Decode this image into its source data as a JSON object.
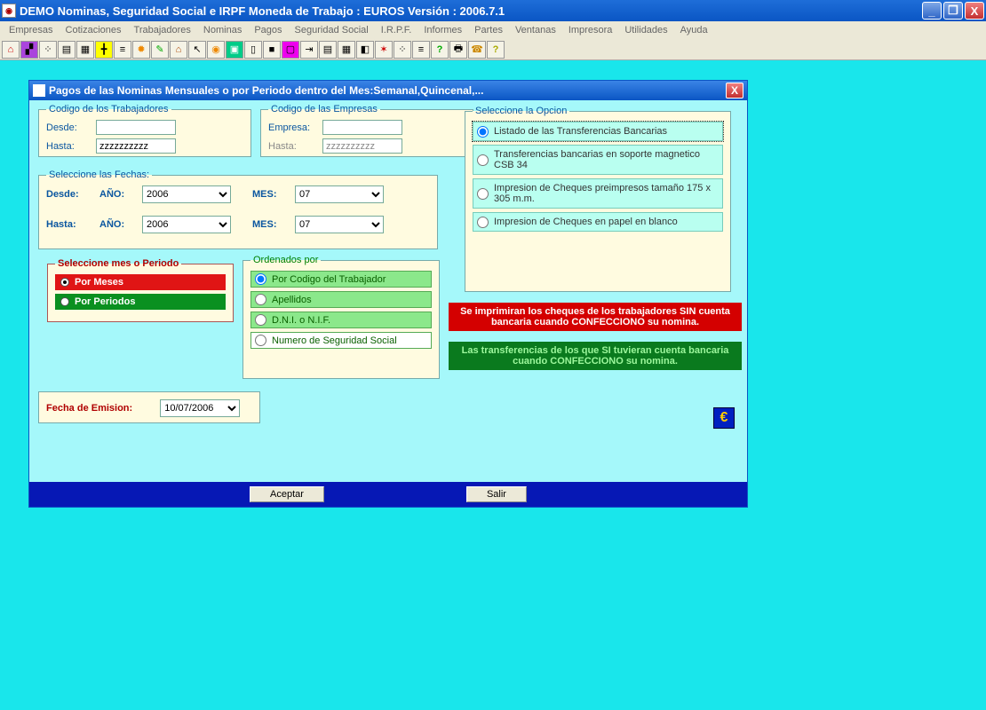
{
  "app": {
    "title": "DEMO Nominas, Seguridad Social e IRPF  Moneda de Trabajo : EUROS  Versión :  2006.7.1"
  },
  "menu": [
    "Empresas",
    "Cotizaciones",
    "Trabajadores",
    "Nominas",
    "Pagos",
    "Seguridad Social",
    "I.R.P.F.",
    "Informes",
    "Partes",
    "Ventanas",
    "Impresora",
    "Utilidades",
    "Ayuda"
  ],
  "dialog": {
    "title": "Pagos de las Nominas Mensuales o por Periodo dentro del Mes:Semanal,Quincenal,...",
    "trabajadores": {
      "legend": "Codigo de los Trabajadores",
      "desde_lbl": "Desde:",
      "desde_val": "",
      "hasta_lbl": "Hasta:",
      "hasta_val": "zzzzzzzzzz"
    },
    "empresas": {
      "legend": "Codigo de las Empresas",
      "empresa_lbl": "Empresa:",
      "empresa_val": "",
      "hasta_lbl": "Hasta:",
      "hasta_val": "zzzzzzzzzz"
    },
    "fechas": {
      "legend": "Seleccione las Fechas:",
      "desde": "Desde:",
      "hasta": "Hasta:",
      "ano": "AÑO:",
      "mes": "MES:",
      "ano_from": "2006",
      "mes_from": "07",
      "ano_to": "2006",
      "mes_to": "07"
    },
    "mesper": {
      "legend": "Seleccione mes o Periodo",
      "meses": "Por Meses",
      "periodos": "Por Periodos"
    },
    "orden": {
      "legend": "Ordenados por",
      "opts": [
        "Por Codigo del Trabajador",
        "Apellidos",
        "D.N.I. o N.I.F.",
        "Numero de Seguridad Social"
      ]
    },
    "opcion": {
      "legend": "Seleccione la Opcion",
      "opts": [
        "Listado de las Transferencias Bancarias",
        "Transferencias bancarias en soporte magnetico CSB 34",
        "Impresion de Cheques preimpresos tamaño 175 x 305 m.m.",
        "Impresion de Cheques en papel en blanco"
      ]
    },
    "emision": {
      "label": "Fecha de Emision:",
      "value": "10/07/2006"
    },
    "banner_red": "Se imprimiran los cheques de los  trabajadores SIN cuenta bancaria cuando CONFECCIONO su nomina.",
    "banner_green": "Las transferencias de los que SI tuvieran cuenta bancaria cuando CONFECCIONO su nomina.",
    "aceptar": "Aceptar",
    "salir": "Salir"
  }
}
